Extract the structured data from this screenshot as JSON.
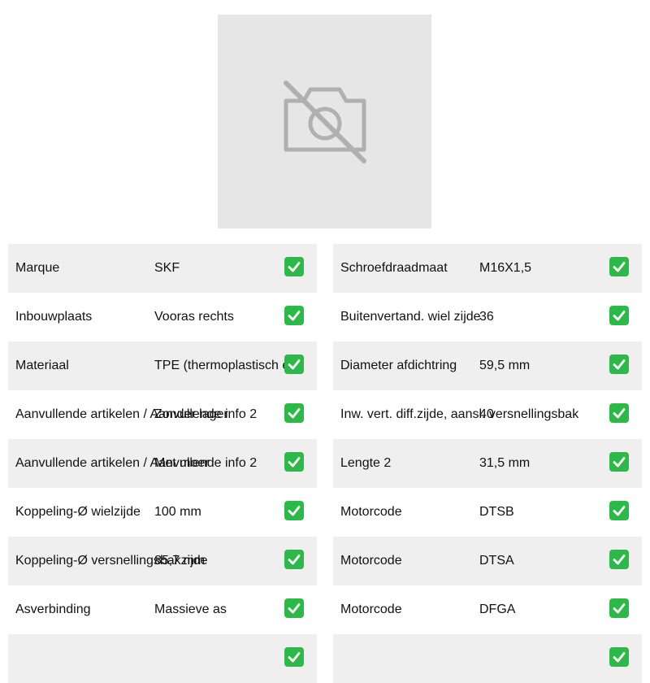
{
  "product_image": {
    "icon": "camera-off-icon"
  },
  "colors": {
    "row_shade": "#efefef",
    "check": "#2fb84a",
    "placeholder": "#e6e6e6"
  },
  "left_specs": [
    {
      "label": "Marque",
      "value": "SKF"
    },
    {
      "label": "Inbouwplaats",
      "value": "Vooras rechts"
    },
    {
      "label": "Materiaal",
      "value": "TPE (thermoplastisch ela"
    },
    {
      "label": "Aanvullende artikelen / Aanvullende info 2",
      "value": "Zonder lager"
    },
    {
      "label": "Aanvullende artikelen / Aanvullende info 2",
      "value": "Met moer"
    },
    {
      "label": "Koppeling-Ø wielzijde",
      "value": "100 mm"
    },
    {
      "label": "Koppeling-Ø versnellingsbakzijde",
      "value": "85,7 mm"
    },
    {
      "label": "Asverbinding",
      "value": "Massieve as"
    },
    {
      "label": "",
      "value": ""
    }
  ],
  "right_specs": [
    {
      "label": "Schroefdraadmaat",
      "value": "M16X1,5"
    },
    {
      "label": "Buitenvertand. wiel zijde",
      "value": "36"
    },
    {
      "label": "Diameter afdichtring",
      "value": "59,5 mm"
    },
    {
      "label": "Inw. vert. diff.zijde, aansl. versnellingsbak",
      "value": "40"
    },
    {
      "label": "Lengte 2",
      "value": "31,5 mm"
    },
    {
      "label": "Motorcode",
      "value": "DTSB"
    },
    {
      "label": "Motorcode",
      "value": "DTSA"
    },
    {
      "label": "Motorcode",
      "value": "DFGA"
    },
    {
      "label": "",
      "value": ""
    }
  ]
}
